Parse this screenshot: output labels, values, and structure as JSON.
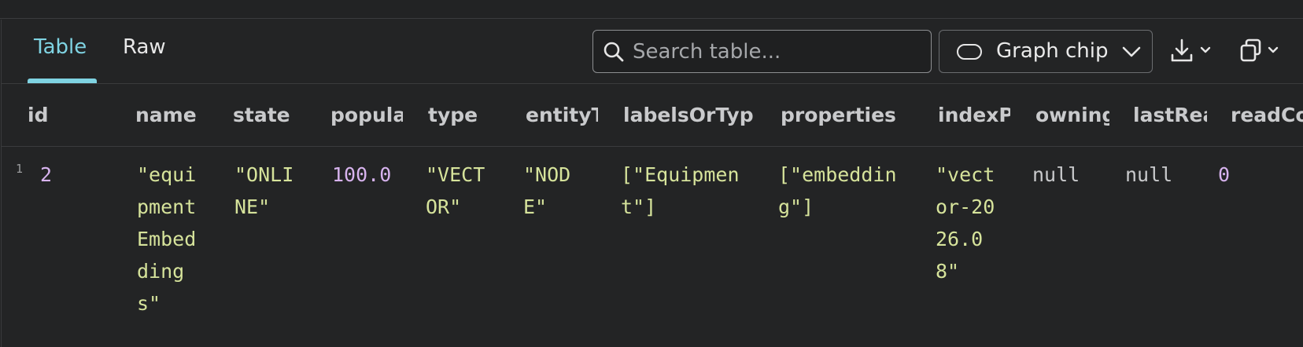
{
  "tabs": [
    {
      "label": "Table",
      "active": true
    },
    {
      "label": "Raw",
      "active": false
    }
  ],
  "search": {
    "placeholder": "Search table..."
  },
  "graph_chip": {
    "label": "Graph chip"
  },
  "icons": {
    "search": "search-icon",
    "graph": "pill-icon",
    "download": "download-icon",
    "copy": "copy-icon",
    "chevron": "chevron-down-icon"
  },
  "colors": {
    "accent": "#7fd3e2",
    "string": "#d6e39b",
    "number": "#d7b3ee",
    "background": "#232425"
  },
  "table": {
    "columns": [
      "id",
      "name",
      "state",
      "popula",
      "type",
      "entityT",
      "labelsOrTyp",
      "properties",
      "indexP",
      "owning",
      "lastRea",
      "readCo"
    ],
    "rows": [
      {
        "row_number": "1",
        "cells": [
          "2",
          "\"equipmentEmbeddings\"",
          "\"ONLINE\"",
          "100.0",
          "\"VECTOR\"",
          "\"NODE\"",
          "[\"Equipment\"]",
          "[\"embedding\"]",
          "\"vector-2026.08\"",
          "null",
          "null",
          "0"
        ]
      }
    ]
  }
}
